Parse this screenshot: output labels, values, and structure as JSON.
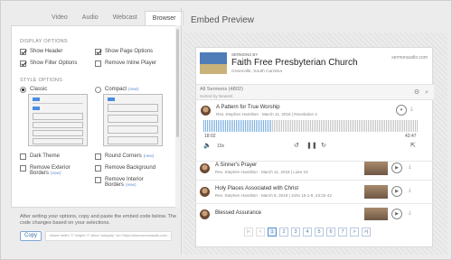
{
  "tabs": [
    "Video",
    "Audio",
    "Webcast",
    "Browser"
  ],
  "display_options": {
    "label": "DISPLAY OPTIONS",
    "items": [
      {
        "label": "Show Header",
        "checked": true
      },
      {
        "label": "Show Page Options",
        "checked": true
      },
      {
        "label": "Show Filter Options",
        "checked": true
      },
      {
        "label": "Remove Inline Player",
        "checked": false
      }
    ]
  },
  "style_options": {
    "label": "STYLE OPTIONS",
    "classic": "Classic",
    "compact": "Compact",
    "new": "(new)"
  },
  "extra_options": [
    {
      "label": "Dark Theme",
      "new": false
    },
    {
      "label": "Round Corners",
      "new": true
    },
    {
      "label": "Remove Exterior Borders",
      "new": true
    },
    {
      "label": "Remove Background",
      "new": false
    },
    {
      "label": "Remove Interior Borders",
      "new": true
    }
  ],
  "footer": {
    "instructions": "After setting your options, copy and paste the embed code below. The code changes based on your selections.",
    "copy_label": "Copy",
    "code": "<iframe width=\"1\" height=\"1\" allow=\"autoplay\" src=\"https://www.sermonaudio.com/...\"></iframe>"
  },
  "preview": {
    "title": "Embed Preview",
    "sermons_by": "SERMONS BY",
    "church_name": "Faith Free Presbyterian Church",
    "location": "Greenville, South Carolina",
    "logo": "sermonaudio.com",
    "all_sermons": "All Sermons (4802)",
    "sorted_by": "Sorted by Newest",
    "sermons": [
      {
        "title": "A Pattern for True Worship",
        "meta": "Rev. Stephen Hamilton · March 11, 2018 | Revelation 4"
      },
      {
        "title": "A Sinner's Prayer",
        "meta": "Rev. Stephen Hamilton · March 11, 2018 | Luke 18"
      },
      {
        "title": "Holy Places Associated with Christ",
        "meta": "Rev. Stephen Hamilton · March 8, 2018 | John 19:1-5; 23:32-42"
      },
      {
        "title": "Blessed Assurance",
        "meta": ""
      }
    ],
    "player": {
      "elapsed": "18:02",
      "total": "43:47",
      "speed": "10x"
    },
    "pages": [
      "1",
      "2",
      "3",
      "4",
      "5",
      "6",
      "7"
    ]
  }
}
